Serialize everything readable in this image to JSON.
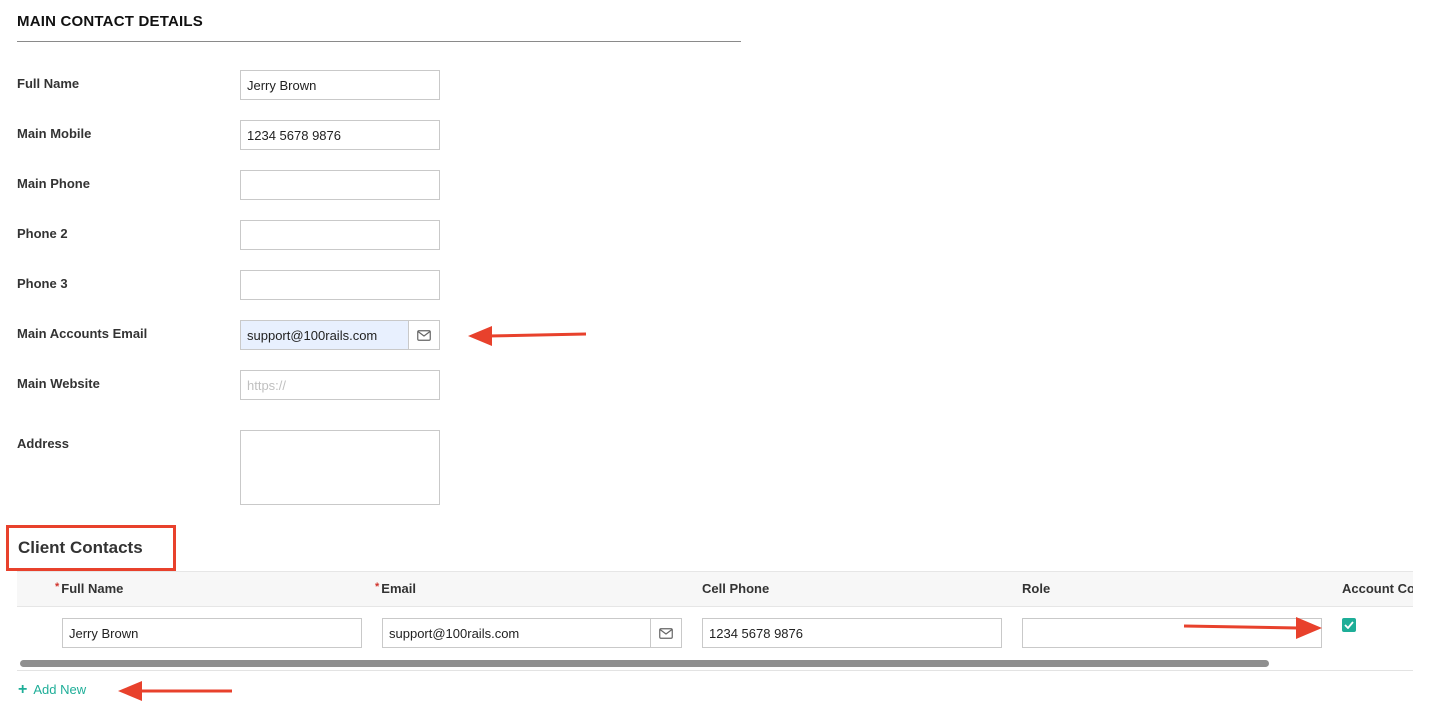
{
  "main_contact": {
    "title": "MAIN CONTACT DETAILS",
    "full_name": {
      "label": "Full Name",
      "value": "Jerry Brown"
    },
    "main_mobile": {
      "label": "Main Mobile",
      "value": "1234 5678 9876"
    },
    "main_phone": {
      "label": "Main Phone",
      "value": ""
    },
    "phone2": {
      "label": "Phone 2",
      "value": ""
    },
    "phone3": {
      "label": "Phone 3",
      "value": ""
    },
    "accounts_email": {
      "label": "Main Accounts Email",
      "value": "support@100rails.com",
      "icon": "envelope-icon"
    },
    "website": {
      "label": "Main Website",
      "value": "",
      "placeholder": "https://"
    },
    "address": {
      "label": "Address",
      "value": ""
    }
  },
  "client_contacts": {
    "title": "Client Contacts",
    "columns": {
      "full_name": "Full Name",
      "email": "Email",
      "cell_phone": "Cell Phone",
      "role": "Role",
      "account_contact": "Account Con"
    },
    "required_marker": "*",
    "rows": [
      {
        "full_name": "Jerry Brown",
        "email": "support@100rails.com",
        "cell_phone": "1234 5678 9876",
        "role": "",
        "account_contact": true
      }
    ],
    "add_new": "Add New"
  },
  "annotation_color": "#e8412c",
  "accent_color": "#1eae98"
}
